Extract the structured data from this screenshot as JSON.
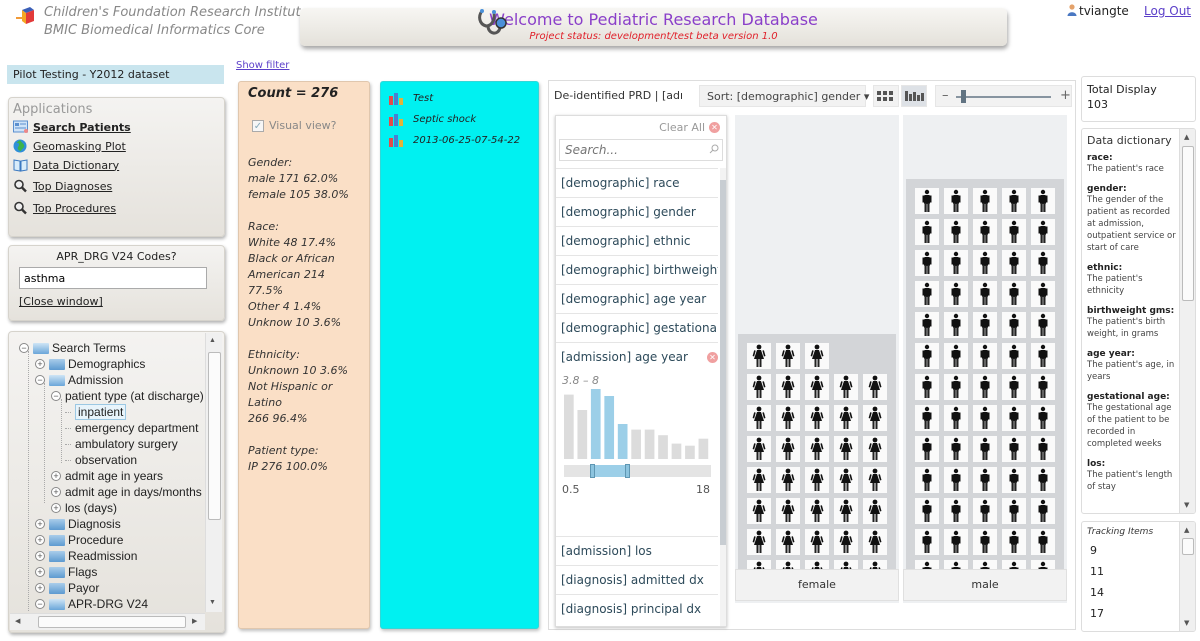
{
  "header": {
    "institute_line1": "Children's Foundation Research Institute",
    "institute_line2": "BMIC Biomedical Informatics Core",
    "welcome_title": "Welcome to Pediatric Research Database",
    "project_status": "Project status: development/test beta version 1.0",
    "username": "tviangte",
    "logout_label": "Log Out"
  },
  "dataset_label": "Pilot Testing - Y2012 dataset",
  "show_filter_label": "Show filter",
  "applications": {
    "title": "Applications",
    "items": [
      {
        "label": "Search Patients",
        "icon": "search-patients-icon",
        "active": true
      },
      {
        "label": "Geomasking Plot",
        "icon": "globe-icon"
      },
      {
        "label": "Data Dictionary",
        "icon": "book-icon"
      },
      {
        "label": "Top Diagnoses",
        "icon": "magnifier-icon"
      },
      {
        "label": "Top Procedures",
        "icon": "magnifier-icon"
      }
    ]
  },
  "apr_drg": {
    "title": "APR_DRG V24 Codes?",
    "input_value": "asthma",
    "close_label": "[Close window]"
  },
  "tree": {
    "nodes": [
      {
        "label": "Search Terms",
        "level": 0,
        "toggle": "minus",
        "folder": "open"
      },
      {
        "label": "Demographics",
        "level": 1,
        "toggle": "plus",
        "folder": "closed"
      },
      {
        "label": "Admission",
        "level": 1,
        "toggle": "minus",
        "folder": "open"
      },
      {
        "label": "patient type (at discharge)",
        "level": 2,
        "toggle": "minus"
      },
      {
        "label": "inpatient",
        "level": 3,
        "selected": true
      },
      {
        "label": "emergency department",
        "level": 3
      },
      {
        "label": "ambulatory surgery",
        "level": 3
      },
      {
        "label": "observation",
        "level": 3
      },
      {
        "label": "admit age in years",
        "level": 2,
        "toggle": "plus"
      },
      {
        "label": "admit age in days/months",
        "level": 2,
        "toggle": "plus"
      },
      {
        "label": "los (days)",
        "level": 2,
        "toggle": "plus"
      },
      {
        "label": "Diagnosis",
        "level": 1,
        "toggle": "plus",
        "folder": "closed"
      },
      {
        "label": "Procedure",
        "level": 1,
        "toggle": "plus",
        "folder": "closed"
      },
      {
        "label": "Readmission",
        "level": 1,
        "toggle": "plus",
        "folder": "closed"
      },
      {
        "label": "Flags",
        "level": 1,
        "toggle": "plus",
        "folder": "closed"
      },
      {
        "label": "Payor",
        "level": 1,
        "toggle": "plus",
        "folder": "closed"
      },
      {
        "label": "APR-DRG V24",
        "level": 1,
        "toggle": "minus",
        "folder": "open"
      }
    ]
  },
  "stats": {
    "count_label": "Count = 276",
    "visual_view_label": "Visual view?",
    "visual_view_checked": true,
    "blocks": [
      "Gender:\nmale 171 62.0%\nfemale 105 38.0%",
      "Race:\nWhite 48 17.4%\nBlack or African\nAmerican 214 77.5%\nOther 4 1.4%\nUnknow 10 3.6%",
      "Ethnicity:\nUnknown 10 3.6%\nNot Hispanic or Latino\n266 96.4%",
      "Patient type:\nIP 276 100.0%"
    ]
  },
  "saved_queries": [
    {
      "label": "Test"
    },
    {
      "label": "Septic shock"
    },
    {
      "label": "2013-06-25-07-54-22"
    }
  ],
  "pivot": {
    "title": "De-identified PRD | [admission] age year",
    "sort_label": "Sort: [demographic] gender ▾",
    "views": [
      "grid-view",
      "histogram-view"
    ],
    "active_view": "histogram-view",
    "zoom_level": 0.05,
    "filter": {
      "clear_all_label": "Clear All",
      "search_placeholder": "Search...",
      "items_before": [
        "[demographic] race",
        "[demographic] gender",
        "[demographic] ethnic",
        "[demographic] birthweight gms",
        "[demographic] age year",
        "[demographic] gestational age"
      ],
      "expanded": {
        "label": "[admission] age year",
        "range_label": "3.8 – 8",
        "min_label": "0.5",
        "max_label": "18",
        "min": 0.5,
        "max": 18,
        "sel_low": 3.8,
        "sel_high": 8,
        "histogram": [
          {
            "value": 9.2,
            "selected": false
          },
          {
            "value": 7.0,
            "selected": false
          },
          {
            "value": 10.0,
            "selected": true
          },
          {
            "value": 9.0,
            "selected": true
          },
          {
            "value": 5.0,
            "selected": true
          },
          {
            "value": 4.2,
            "selected": false
          },
          {
            "value": 4.2,
            "selected": false
          },
          {
            "value": 3.4,
            "selected": false
          },
          {
            "value": 2.2,
            "selected": false
          },
          {
            "value": 1.9,
            "selected": false
          },
          {
            "value": 2.9,
            "selected": false
          }
        ]
      },
      "items_after": [
        "[admission] los",
        "[diagnosis] admitted dx",
        "[diagnosis] principal dx"
      ]
    },
    "columns": [
      {
        "label": "female",
        "count": 38,
        "icon": "female-figure-icon"
      },
      {
        "label": "male",
        "count": 65,
        "icon": "male-figure-icon"
      }
    ],
    "items_per_row": 5
  },
  "total_display": {
    "label": "Total Display",
    "value": "103"
  },
  "data_dictionary": {
    "title": "Data dictionary",
    "entries": [
      {
        "term": "race:",
        "def": "The patient's race"
      },
      {
        "term": "gender:",
        "def": "The gender of the patient as recorded at admission, outpatient service or start of care"
      },
      {
        "term": "ethnic:",
        "def": "The patient's ethnicity"
      },
      {
        "term": "birthweight gms:",
        "def": "The patient's birth weight, in grams"
      },
      {
        "term": "age year:",
        "def": "The patient's age, in years"
      },
      {
        "term": "gestational age:",
        "def": "The gestational age of the patient to be recorded in completed weeks"
      },
      {
        "term": "los:",
        "def": "The patient's length of stay"
      }
    ]
  },
  "tracking": {
    "title": "Tracking Items",
    "items": [
      "9",
      "11",
      "14",
      "17"
    ]
  }
}
